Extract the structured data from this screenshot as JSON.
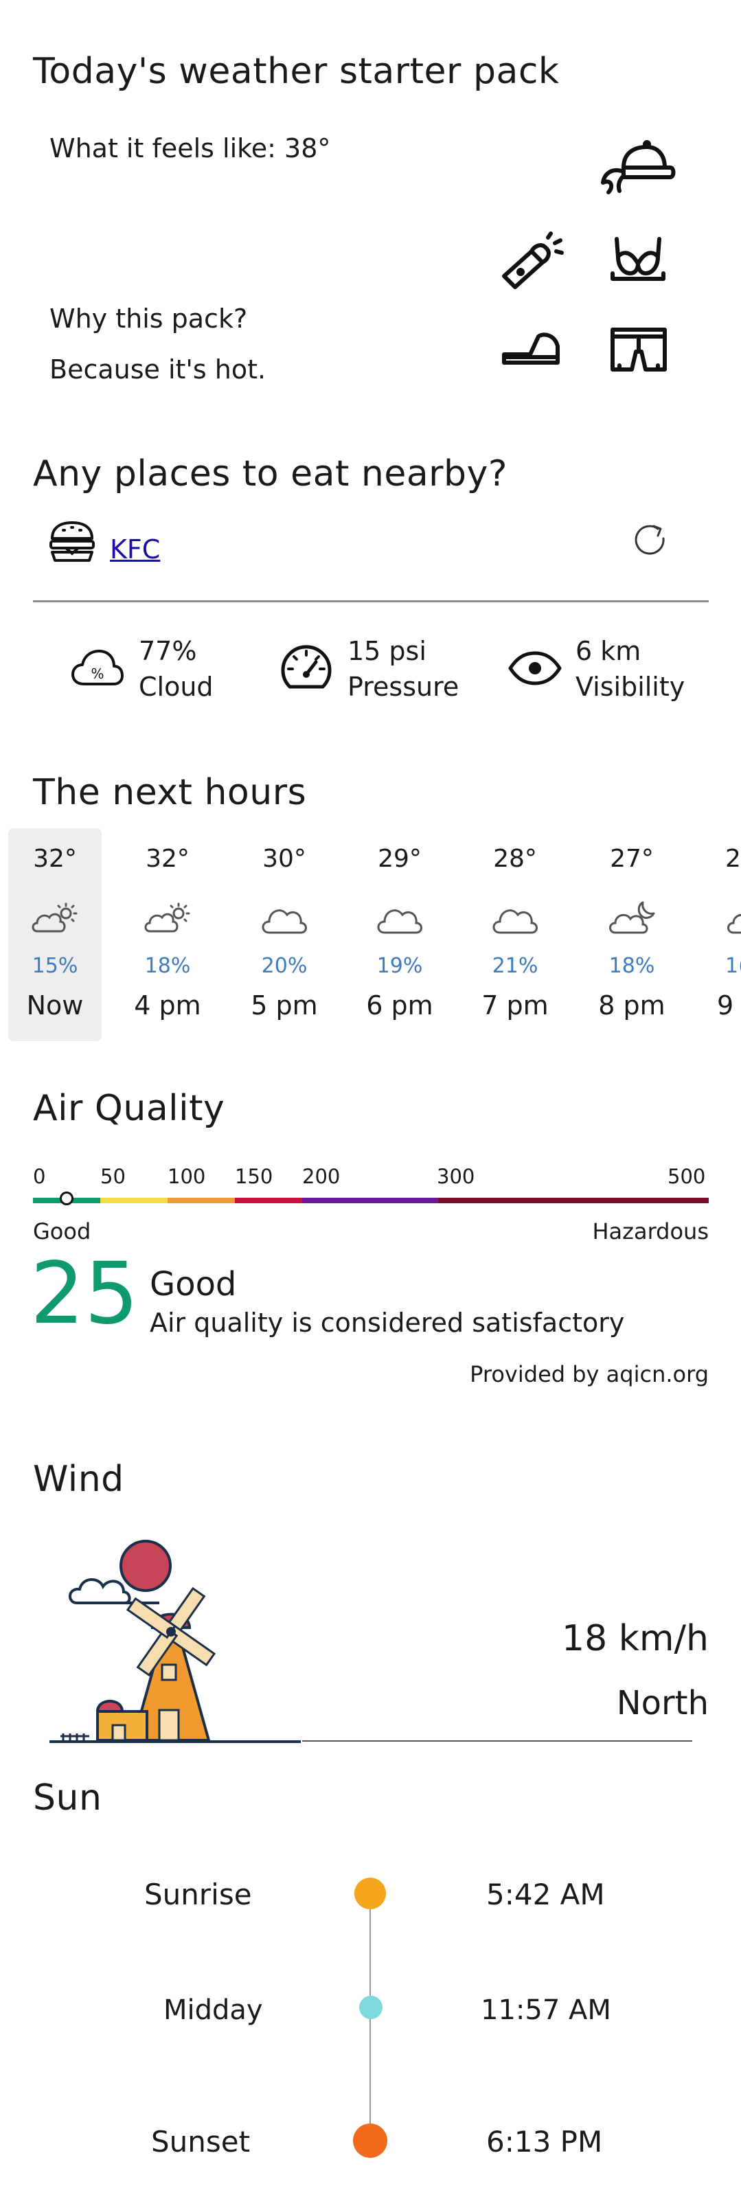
{
  "starter_pack": {
    "title": "Today's weather starter pack",
    "feels_like": "What it feels like: 38°",
    "why_title": "Why this pack?",
    "why_reason": "Because it's hot.",
    "items": [
      "cap-icon",
      "flashlight-icon",
      "bra-icon",
      "sandal-icon",
      "shorts-icon"
    ]
  },
  "places": {
    "title": "Any places to eat nearby?",
    "place_name": "KFC",
    "place_icon": "burger-icon",
    "refresh_icon": "refresh-icon"
  },
  "stats": [
    {
      "value": "77%",
      "label": "Cloud",
      "icon": "cloud-percent-icon"
    },
    {
      "value": "15 psi",
      "label": "Pressure",
      "icon": "gauge-icon"
    },
    {
      "value": "6 km",
      "label": "Visibility",
      "icon": "eye-icon"
    }
  ],
  "hours": {
    "title": "The next hours",
    "items": [
      {
        "temp": "32°",
        "precip": "15%",
        "time": "Now",
        "icon": "partly-sunny-icon"
      },
      {
        "temp": "32°",
        "precip": "18%",
        "time": "4 pm",
        "icon": "partly-sunny-icon"
      },
      {
        "temp": "30°",
        "precip": "20%",
        "time": "5 pm",
        "icon": "cloud-icon"
      },
      {
        "temp": "29°",
        "precip": "19%",
        "time": "6 pm",
        "icon": "cloud-icon"
      },
      {
        "temp": "28°",
        "precip": "21%",
        "time": "7 pm",
        "icon": "cloud-icon"
      },
      {
        "temp": "27°",
        "precip": "18%",
        "time": "8 pm",
        "icon": "partly-cloudy-night-icon"
      },
      {
        "temp": "2",
        "precip": "1(",
        "time": "9",
        "icon": "partly-cloudy-night-icon"
      }
    ]
  },
  "air_quality": {
    "title": "Air Quality",
    "scale_labels": [
      "0",
      "50",
      "100",
      "150",
      "200",
      "300",
      "500"
    ],
    "scale_colors": [
      "#0e9a6e",
      "#f3dc48",
      "#ef9a3d",
      "#c8123c",
      "#6a1a9e",
      "#7b0f2a"
    ],
    "value": 25,
    "value_text": "25",
    "low_label": "Good",
    "high_label": "Hazardous",
    "status": "Good",
    "description": "Air quality is considered satisfactory",
    "provider": "Provided by aqicn.org",
    "value_color": "#0e9a6e"
  },
  "wind": {
    "title": "Wind",
    "speed": "18 km/h",
    "direction": "North"
  },
  "sun": {
    "title": "Sun",
    "events": [
      {
        "label": "Sunrise",
        "time": "5:42 AM",
        "color": "#f7a51c"
      },
      {
        "label": "Midday",
        "time": "11:57 AM",
        "color": "#7fd8dc"
      },
      {
        "label": "Sunset",
        "time": "6:13 PM",
        "color": "#f26b1d"
      }
    ]
  }
}
